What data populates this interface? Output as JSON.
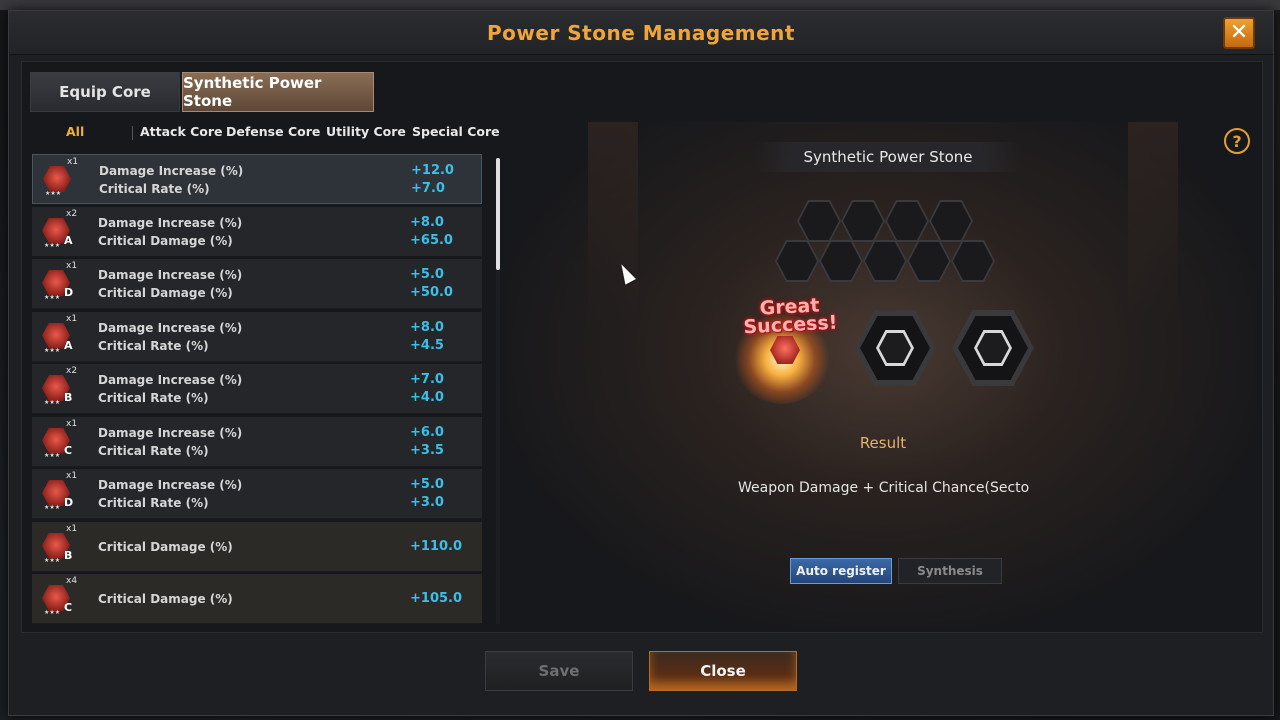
{
  "window": {
    "title": "Power Stone Management",
    "close_glyph": "✕"
  },
  "tabs": [
    {
      "label": "Equip Core",
      "active": false
    },
    {
      "label": "Synthetic Power Stone",
      "active": true
    }
  ],
  "categories": [
    "All",
    "Attack Core",
    "Defense Core",
    "Utility Core",
    "Special Core"
  ],
  "stones": [
    {
      "qty": "x1",
      "grade": "",
      "stats": [
        "Damage Increase (%)",
        "Critical Rate (%)"
      ],
      "values": [
        "+12.0",
        "+7.0"
      ],
      "selected": true
    },
    {
      "qty": "x2",
      "grade": "A",
      "stats": [
        "Damage Increase (%)",
        "Critical Damage (%)"
      ],
      "values": [
        "+8.0",
        "+65.0"
      ]
    },
    {
      "qty": "x1",
      "grade": "D",
      "stats": [
        "Damage Increase (%)",
        "Critical Damage (%)"
      ],
      "values": [
        "+5.0",
        "+50.0"
      ]
    },
    {
      "qty": "x1",
      "grade": "A",
      "stats": [
        "Damage Increase (%)",
        "Critical Rate (%)"
      ],
      "values": [
        "+8.0",
        "+4.5"
      ]
    },
    {
      "qty": "x2",
      "grade": "B",
      "stats": [
        "Damage Increase (%)",
        "Critical Rate (%)"
      ],
      "values": [
        "+7.0",
        "+4.0"
      ]
    },
    {
      "qty": "x1",
      "grade": "C",
      "stats": [
        "Damage Increase (%)",
        "Critical Rate (%)"
      ],
      "values": [
        "+6.0",
        "+3.5"
      ]
    },
    {
      "qty": "x1",
      "grade": "D",
      "stats": [
        "Damage Increase (%)",
        "Critical Rate (%)"
      ],
      "values": [
        "+5.0",
        "+3.0"
      ]
    },
    {
      "qty": "x1",
      "grade": "B",
      "stats": [
        "Critical Damage (%)"
      ],
      "values": [
        "+110.0"
      ]
    },
    {
      "qty": "x4",
      "grade": "C",
      "stats": [
        "Critical Damage (%)"
      ],
      "values": [
        "+105.0"
      ]
    }
  ],
  "synthesis": {
    "title": "Synthetic Power Stone",
    "great_success": "Great Success!",
    "result_label": "Result",
    "result_text": "Weapon Damage + Critical Chance(Sector Re",
    "auto_register": "Auto register",
    "synthesis_button": "Synthesis",
    "help_glyph": "?"
  },
  "footer": {
    "save": "Save",
    "close": "Close"
  },
  "icons": {
    "close": "close-icon",
    "help": "help-icon",
    "stone": "power-stone-icon",
    "cursor": "mouse-cursor-icon"
  },
  "colors": {
    "title": "#f0a53a",
    "stat_value": "#3ac0e8",
    "active_tab": "#8a6d55",
    "auto_register": "#3a6aa8",
    "close_button": "#b86a28"
  }
}
